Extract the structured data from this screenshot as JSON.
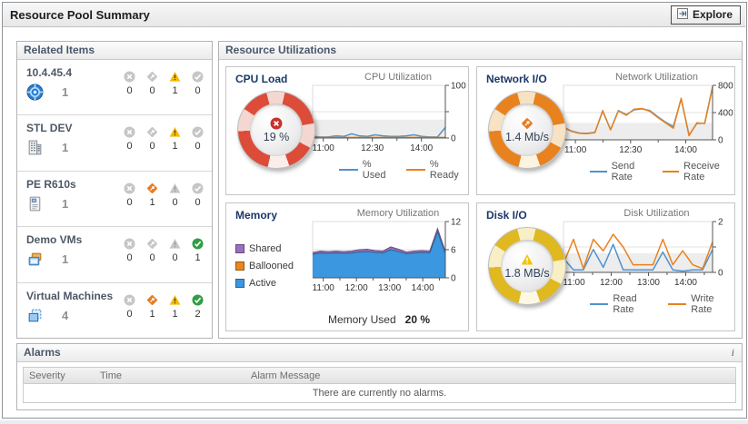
{
  "header": {
    "title": "Resource Pool Summary",
    "explore_label": "Explore"
  },
  "related_items": {
    "title": "Related Items",
    "items": [
      {
        "name": "10.4.45.4",
        "count": 1,
        "icon": "esx-host-icon",
        "fatal": 0,
        "critical": 0,
        "warning": 1,
        "normal": 0
      },
      {
        "name": "STL DEV",
        "count": 1,
        "icon": "datacenter-icon",
        "fatal": 0,
        "critical": 0,
        "warning": 1,
        "normal": 0
      },
      {
        "name": "PE R610s",
        "count": 1,
        "icon": "cluster-icon",
        "fatal": 0,
        "critical": 1,
        "warning": 0,
        "normal": 0
      },
      {
        "name": "Demo VMs",
        "count": 1,
        "icon": "resource-pool-icon",
        "fatal": 0,
        "critical": 0,
        "warning": 0,
        "normal": 1
      },
      {
        "name": "Virtual Machines",
        "count": 4,
        "icon": "virtual-machine-icon",
        "fatal": 0,
        "critical": 1,
        "warning": 1,
        "normal": 2
      }
    ]
  },
  "resource_utilizations": {
    "title": "Resource Utilizations",
    "cpu": {
      "title": "CPU Load",
      "value": "19 %",
      "status": "fatal"
    },
    "network": {
      "title": "Network I/O",
      "value": "1.4 Mb/s",
      "status": "critical"
    },
    "memory": {
      "title": "Memory",
      "used_label": "Memory Used",
      "used_value": "20 %"
    },
    "disk": {
      "title": "Disk I/O",
      "value": "1.8 MB/s",
      "status": "warning"
    }
  },
  "alarms": {
    "title": "Alarms",
    "info_icon": "i",
    "columns": [
      "Severity",
      "Time",
      "Alarm Message"
    ],
    "empty_message": "There are currently no alarms."
  },
  "colors": {
    "used_line": "#4f93ce",
    "ready_line": "#e8821e",
    "active_area": "#3a97e0",
    "ballooned_area": "#e8871e",
    "shared_area": "#9a6fc0",
    "fatal": "#d0342c",
    "critical": "#e87c1e",
    "warning": "#f5bc00",
    "normal": "#2f9e44"
  },
  "chart_data": [
    {
      "type": "line",
      "title": "CPU Utilization",
      "unit": "%",
      "ylim": [
        0,
        100
      ],
      "threshold_band_max": 35,
      "y_ticks": [
        {
          "v": 0,
          "l": "0"
        },
        {
          "v": 50,
          "l": ""
        },
        {
          "v": 100,
          "l": "100"
        }
      ],
      "x_ticks": [
        {
          "label": "11:00",
          "pos": 0.08
        },
        {
          "label": "12:30",
          "pos": 0.45
        },
        {
          "label": "14:00",
          "pos": 0.82
        }
      ],
      "series": [
        {
          "name": "% Used",
          "color": "#4f93ce",
          "values": [
            3,
            2,
            2,
            4,
            3,
            8,
            4,
            3,
            6,
            4,
            3,
            3,
            4,
            6,
            3,
            2,
            2,
            20
          ]
        },
        {
          "name": "% Ready",
          "color": "#e8821e",
          "values": [
            1,
            1,
            1,
            1,
            1,
            1,
            1,
            1,
            1,
            1,
            1,
            1,
            1,
            1,
            1,
            1,
            1,
            1
          ]
        }
      ]
    },
    {
      "type": "line",
      "title": "Network Utilization",
      "unit": "Kb/s",
      "ylim": [
        0,
        800
      ],
      "threshold_band_max": 250,
      "y_ticks": [
        {
          "v": 0,
          "l": "0"
        },
        {
          "v": 400,
          "l": "400"
        },
        {
          "v": 800,
          "l": "800"
        }
      ],
      "x_ticks": [
        {
          "label": "11:00",
          "pos": 0.08
        },
        {
          "label": "12:30",
          "pos": 0.45
        },
        {
          "label": "14:00",
          "pos": 0.82
        }
      ],
      "series": [
        {
          "name": "Send Rate",
          "color": "#4f93ce",
          "values": [
            180,
            130,
            100,
            95,
            110,
            420,
            150,
            430,
            370,
            440,
            455,
            430,
            340,
            260,
            195,
            600,
            70,
            240,
            245,
            780
          ]
        },
        {
          "name": "Receive Rate",
          "color": "#e8821e",
          "values": [
            190,
            125,
            95,
            90,
            105,
            430,
            145,
            425,
            360,
            450,
            460,
            420,
            330,
            250,
            170,
            610,
            60,
            250,
            240,
            770
          ]
        }
      ]
    },
    {
      "type": "area",
      "stacked": true,
      "title": "Memory Utilization",
      "unit": "GB",
      "ylim": [
        0,
        12
      ],
      "y_ticks": [
        {
          "v": 0,
          "l": "0"
        },
        {
          "v": 6,
          "l": "6"
        },
        {
          "v": 12,
          "l": "12"
        }
      ],
      "x_ticks": [
        {
          "label": "11:00",
          "pos": 0.08
        },
        {
          "label": "12:00",
          "pos": 0.33
        },
        {
          "label": "13:00",
          "pos": 0.58
        },
        {
          "label": "14:00",
          "pos": 0.83
        }
      ],
      "series": [
        {
          "name": "Active",
          "color": "#3a97e0",
          "values": [
            5.0,
            5.3,
            5.2,
            5.3,
            5.2,
            5.3,
            5.5,
            5.6,
            5.4,
            5.3,
            6.0,
            5.6,
            5.1,
            5.3,
            5.4,
            5.3,
            9.8,
            5.2
          ]
        },
        {
          "name": "Ballooned",
          "color": "#e8871e",
          "values": [
            0,
            0,
            0,
            0,
            0,
            0,
            0,
            0,
            0,
            0,
            0,
            0,
            0,
            0,
            0,
            0,
            0,
            0
          ]
        },
        {
          "name": "Shared",
          "color": "#9a6fc0",
          "values": [
            0.4,
            0.4,
            0.4,
            0.4,
            0.4,
            0.4,
            0.5,
            0.5,
            0.4,
            0.4,
            0.6,
            0.5,
            0.4,
            0.4,
            0.4,
            0.4,
            0.7,
            0.4
          ]
        }
      ],
      "memory_used_pct": 20
    },
    {
      "type": "line",
      "title": "Disk Utilization",
      "unit": "MB/s",
      "ylim": [
        0,
        2
      ],
      "threshold_band_max": 0.75,
      "y_ticks": [
        {
          "v": 0,
          "l": "0"
        },
        {
          "v": 1,
          "l": ""
        },
        {
          "v": 2,
          "l": "2"
        }
      ],
      "x_ticks": [
        {
          "label": "11:00",
          "pos": 0.07
        },
        {
          "label": "12:00",
          "pos": 0.32
        },
        {
          "label": "13:00",
          "pos": 0.57
        },
        {
          "label": "14:00",
          "pos": 0.82
        }
      ],
      "series": [
        {
          "name": "Read Rate",
          "color": "#4f93ce",
          "values": [
            0.55,
            0.1,
            0.1,
            0.9,
            0.2,
            1.1,
            0.1,
            0.1,
            0.1,
            0.1,
            0.8,
            0.1,
            0.05,
            0.1,
            0.1,
            0.9
          ]
        },
        {
          "name": "Write Rate",
          "color": "#e8821e",
          "values": [
            0.35,
            1.3,
            0.15,
            1.3,
            0.85,
            1.5,
            1.0,
            0.3,
            0.3,
            0.3,
            1.3,
            0.3,
            0.85,
            0.3,
            0.15,
            1.2
          ]
        }
      ]
    }
  ]
}
